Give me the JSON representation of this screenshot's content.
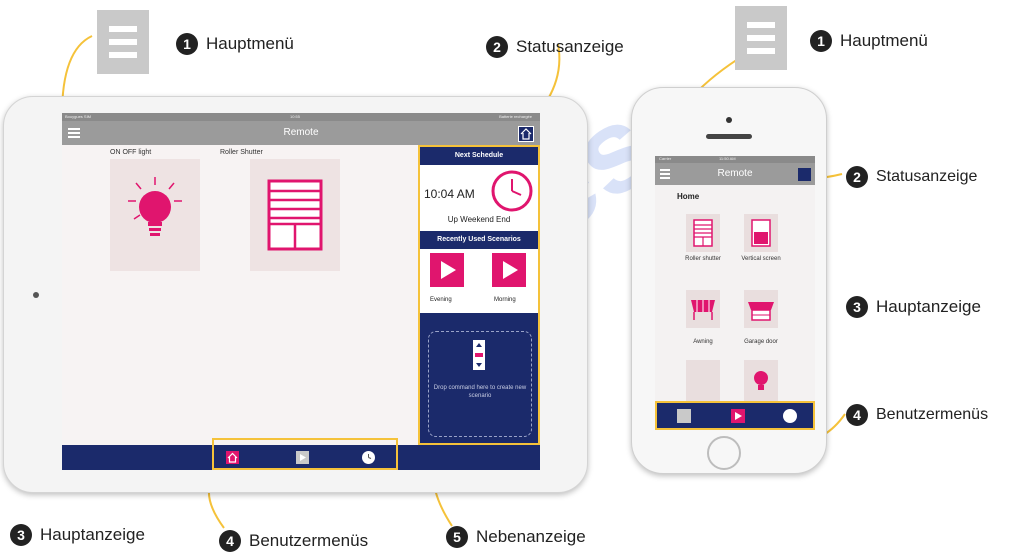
{
  "callouts": {
    "c1_left": {
      "num": "1",
      "label": "Hauptmenü"
    },
    "c2_left": {
      "num": "2",
      "label": "Statusanzeige"
    },
    "c1_right": {
      "num": "1",
      "label": "Hauptmenü"
    },
    "c2_right": {
      "num": "2",
      "label": "Statusanzeige"
    },
    "c3_right": {
      "num": "3",
      "label": "Hauptanzeige"
    },
    "c4_right": {
      "num": "4",
      "label": "Benutzermenüs"
    },
    "c3_bottom": {
      "num": "3",
      "label": "Hauptanzeige"
    },
    "c4_bottom": {
      "num": "4",
      "label": "Benutzermenüs"
    },
    "c5_bottom": {
      "num": "5",
      "label": "Nebenanzeige"
    }
  },
  "tablet": {
    "status_left": "Bouygues SIM",
    "status_center": "10:55",
    "status_right": "Batterie rechargée",
    "title": "Remote",
    "tiles": [
      {
        "label": "ON OFF light",
        "icon": "light-bulb-icon"
      },
      {
        "label": "Roller Shutter",
        "icon": "roller-shutter-icon"
      }
    ],
    "side": {
      "next_schedule": "Next Schedule",
      "time": "10:04 AM",
      "schedule_name": "Up Weekend End",
      "recent": "Recently Used Scenarios",
      "scenarios": [
        "Evening",
        "Morning"
      ],
      "drop_text": "Drop command here to create new scenario"
    }
  },
  "phone": {
    "status_left": "Carrier",
    "status_center": "11:50 AM",
    "title": "Remote",
    "section": "Home",
    "tiles": [
      {
        "label": "Roller shutter",
        "icon": "roller-shutter-icon"
      },
      {
        "label": "Vertical screen",
        "icon": "vertical-screen-icon"
      },
      {
        "label": "Awning",
        "icon": "awning-icon"
      },
      {
        "label": "Garage door",
        "icon": "garage-door-icon"
      }
    ]
  },
  "colors": {
    "navy": "#1b2a6b",
    "magenta": "#e0156e",
    "highlight": "#f5c23a",
    "arrow": "#f5c23a"
  },
  "watermark": "bieces"
}
